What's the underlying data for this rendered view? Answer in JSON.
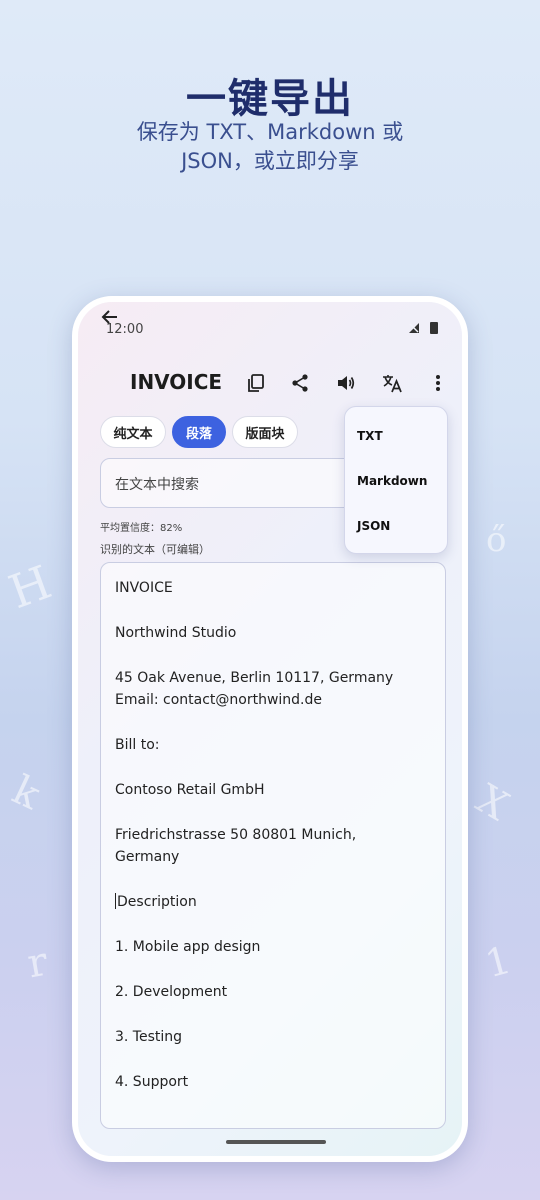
{
  "promo": {
    "headline": "一键导出",
    "subline": "保存为 TXT、Markdown 或 JSON，或立即分享"
  },
  "status": {
    "time": "12:00"
  },
  "appbar": {
    "title": "INVOICE",
    "icons": [
      "back-arrow-icon",
      "copy-icon",
      "share-icon",
      "volume-icon",
      "translate-icon",
      "more-vert-icon"
    ]
  },
  "chips": [
    {
      "label": "纯文本",
      "active": false
    },
    {
      "label": "段落",
      "active": true
    },
    {
      "label": "版面块",
      "active": false
    }
  ],
  "search": {
    "placeholder": "在文本中搜索"
  },
  "confidence_label": "平均置信度：82%",
  "recognized_label": "识别的文本（可编辑）",
  "editor": {
    "lines": [
      "INVOICE",
      "Northwind Studio",
      "45 Oak Avenue, Berlin 10117, Germany",
      "Email: contact@northwind.de",
      "Bill to:",
      "Contoso Retail GmbH",
      "Friedrichstrasse 50 80801 Munich,",
      "Germany",
      "Description",
      "1. Mobile app design",
      "2. Development",
      "3. Testing",
      "4. Support"
    ]
  },
  "export_menu": {
    "items": [
      "TXT",
      "Markdown",
      "JSON"
    ]
  },
  "colors": {
    "accent": "#3d62e0",
    "headline": "#1f2d6b"
  }
}
